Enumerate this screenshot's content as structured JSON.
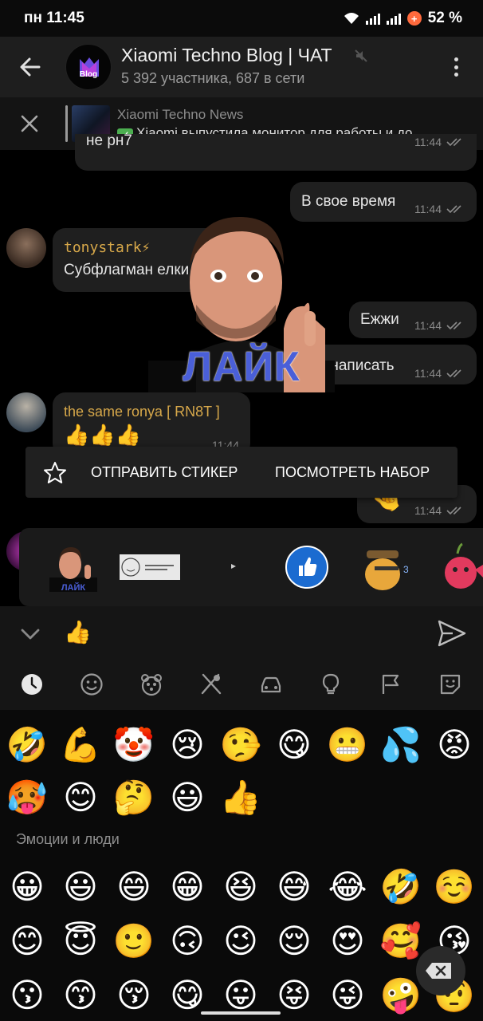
{
  "status_bar": {
    "time": "пн 11:45",
    "battery": "52 %"
  },
  "header": {
    "title": "Xiaomi Techno Blog | ЧАТ",
    "subtitle": "5 392 участника, 687 в сети",
    "avatar_label": "Blog"
  },
  "pinned": {
    "title": "Xiaomi Techno News",
    "text": "Xiaomi выпустила монитор для работы и до..."
  },
  "messages": [
    {
      "text": "не рн7",
      "time": "11:44",
      "side": "in"
    },
    {
      "text": "В свое время",
      "time": "11:44",
      "side": "out"
    },
    {
      "sender": "tonystark⚡",
      "text": "Субфлагман елки",
      "side": "in"
    },
    {
      "text": "Ежжи",
      "time": "11:44",
      "side": "out"
    },
    {
      "text": "л написать",
      "time": "11:44",
      "side": "out"
    },
    {
      "sender": "the same ronya [ RN8T ]",
      "text": "👍👍👍",
      "time": "11:44",
      "side": "in"
    },
    {
      "time": "11:44",
      "side": "out"
    }
  ],
  "sticker_preview": {
    "caption": "ЛАЙК"
  },
  "context_menu": {
    "send": "ОТПРАВИТЬ СТИКЕР",
    "view": "ПОСМОТРЕТЬ НАБОР"
  },
  "input": {
    "value": "👍"
  },
  "emoji_tabs": [
    "recent-icon",
    "smile-icon",
    "animal-icon",
    "food-icon",
    "car-icon",
    "bulb-icon",
    "flag-icon",
    "sticker-icon"
  ],
  "emoji_recent": [
    "🤣",
    "💪",
    "🤡",
    "😢",
    "🤥",
    "😋",
    "😬",
    "💦",
    "😡",
    "🥵",
    "😊",
    "🤔",
    "😃",
    "👍"
  ],
  "emoji_section": "Эмоции и люди",
  "emoji_people": [
    "😀",
    "😃",
    "😄",
    "😁",
    "😆",
    "😅",
    "😂",
    "🤣",
    "☺️",
    "😊",
    "😇",
    "🙂",
    "🙃",
    "😉",
    "😌",
    "😍",
    "🥰",
    "😘",
    "😗",
    "😙",
    "😚",
    "😋",
    "😛",
    "😝",
    "😜",
    "🤪",
    "🤨"
  ],
  "colors": {
    "accent": "#d7a84a",
    "bubble": "#1f1f1f",
    "header": "#1e1e1e",
    "background": "#000000"
  }
}
